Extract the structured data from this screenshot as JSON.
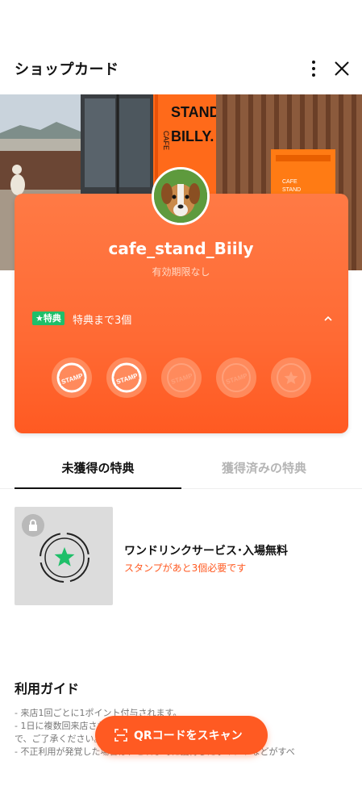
{
  "header": {
    "title": "ショップカード",
    "more_icon": "more-vertical-icon",
    "close_icon": "close-icon"
  },
  "hero": {
    "sign_text": "STAND BILLY.",
    "sign_side_text": "CAFE",
    "mailbox_text": "CAFE STAND BI"
  },
  "card": {
    "shop_name": "cafe_stand_Biily",
    "validity": "有効期限なし",
    "reward_badge": "★特典",
    "reward_progress": "特典まで3個",
    "stamps_total": 5,
    "stamps_collected": 2,
    "stamp_label": "STAMP",
    "accent_color": "#ff5a22"
  },
  "tabs": [
    {
      "label": "未獲得の特典",
      "active": true
    },
    {
      "label": "獲得済みの特典",
      "active": false
    }
  ],
  "benefit": {
    "title": "ワンドリンクサービス･入場無料",
    "subtitle": "スタンプがあと3個必要です"
  },
  "guide": {
    "title": "利用ガイド",
    "lines": [
      "- 来店1回ごとに1ポイント付与されます。",
      "- 1日に複数回来店された場合も1ポイントのみ付与されますの",
      "で、ご了承ください。",
      "- 不正利用が発覚した場合は、これまでに獲得したポイントなどがすべ"
    ]
  },
  "qr_button": {
    "label": "QRコードをスキャン"
  }
}
